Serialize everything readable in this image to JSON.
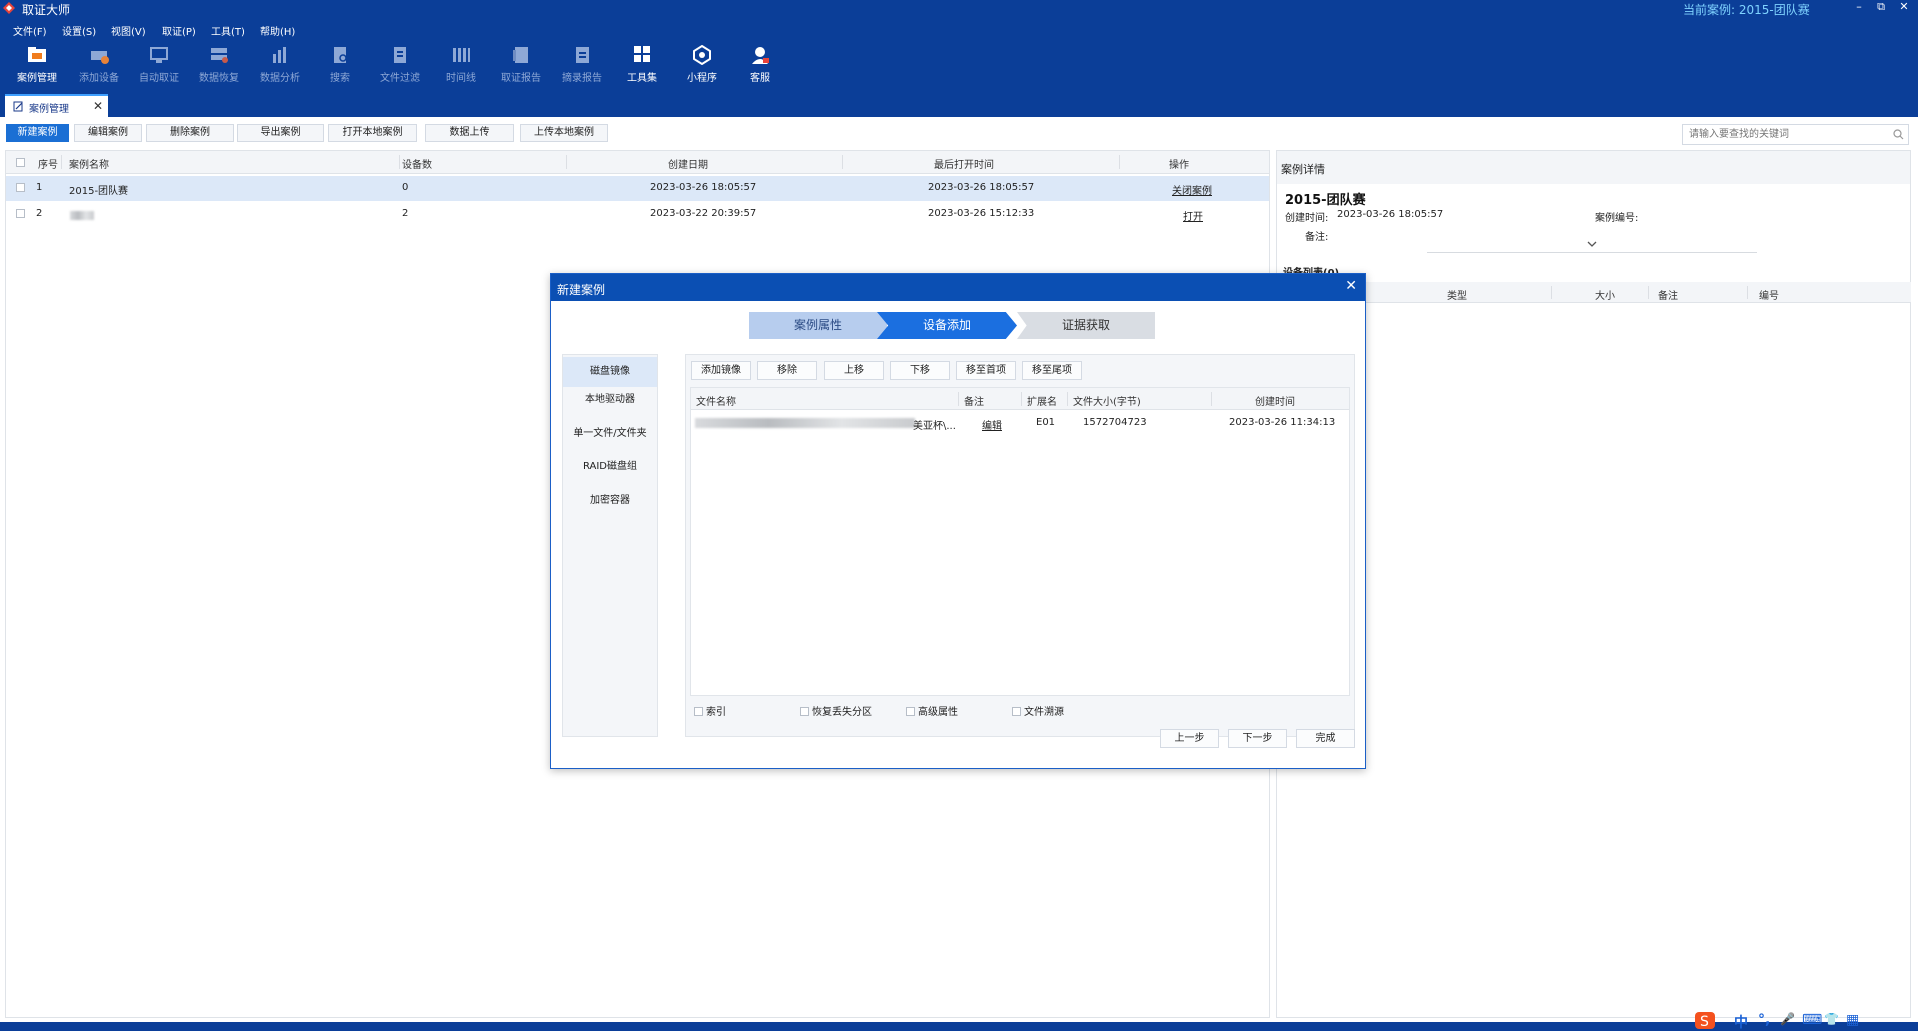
{
  "app": {
    "title": "取证大师",
    "current_case_label": "当前案例: 2015-团队赛",
    "window_buttons": [
      "–",
      "⧉",
      "✕"
    ]
  },
  "menu": [
    "文件(F)",
    "设置(S)",
    "视图(V)",
    "取证(P)",
    "工具(T)",
    "帮助(H)"
  ],
  "toolbar": [
    {
      "label": "案例管理",
      "icon": "case-manage-icon"
    },
    {
      "label": "添加设备",
      "icon": "add-device-icon"
    },
    {
      "label": "自动取证",
      "icon": "auto-forensic-icon"
    },
    {
      "label": "数据恢复",
      "icon": "data-recovery-icon"
    },
    {
      "label": "数据分析",
      "icon": "data-analysis-icon"
    },
    {
      "label": "搜索",
      "icon": "search-doc-icon"
    },
    {
      "label": "文件过滤",
      "icon": "file-filter-icon"
    },
    {
      "label": "时间线",
      "icon": "timeline-icon"
    },
    {
      "label": "取证报告",
      "icon": "report-icon"
    },
    {
      "label": "摘录报告",
      "icon": "excerpt-report-icon"
    },
    {
      "label": "工具集",
      "icon": "toolset-icon"
    },
    {
      "label": "小程序",
      "icon": "mini-program-icon"
    },
    {
      "label": "客服",
      "icon": "customer-service-icon"
    }
  ],
  "tab": {
    "label": "案例管理",
    "close": "✕"
  },
  "actions": [
    "新建案例",
    "编辑案例",
    "删除案例",
    "导出案例",
    "打开本地案例",
    "数据上传",
    "上传本地案例"
  ],
  "search": {
    "placeholder": "请输入要查找的关键词"
  },
  "case_table": {
    "headers": [
      "序号",
      "案例名称",
      "设备数",
      "创建日期",
      "最后打开时间",
      "操作"
    ],
    "rows": [
      {
        "index": "1",
        "name": "2015-团队赛",
        "devices": "0",
        "created": "2023-03-26 18:05:57",
        "last_opened": "2023-03-26 18:05:57",
        "action": "关闭案例"
      },
      {
        "index": "2",
        "name": "",
        "devices": "2",
        "created": "2023-03-22 20:39:57",
        "last_opened": "2023-03-26 15:12:33",
        "action": "打开"
      }
    ]
  },
  "detail": {
    "header": "案例详情",
    "title": "2015-团队赛",
    "created_label": "创建时间:",
    "created_value": "2023-03-26 18:05:57",
    "case_no_label": "案例编号:",
    "remark_label": "备注:",
    "device_list_label": "设备列表(0)",
    "device_headers": [
      "类型",
      "大小",
      "备注",
      "编号"
    ]
  },
  "dialog": {
    "title": "新建案例",
    "steps": [
      "案例属性",
      "设备添加",
      "证据获取"
    ],
    "side_items": [
      "磁盘镜像",
      "本地驱动器",
      "单一文件/文件夹",
      "RAID磁盘组",
      "加密容器"
    ],
    "buttons": [
      "添加镜像",
      "移除",
      "上移",
      "下移",
      "移至首项",
      "移至尾项"
    ],
    "file_headers": [
      "文件名称",
      "备注",
      "扩展名",
      "文件大小(字节)",
      "创建时间"
    ],
    "file_rows": [
      {
        "name_tail": "美亚杯\\...",
        "remark": "编辑",
        "ext": "E01",
        "size": "1572704723",
        "created": "2023-03-26 11:34:13"
      }
    ],
    "options": [
      "索引",
      "恢复丢失分区",
      "高级属性",
      "文件溯源"
    ],
    "footer": [
      "上一步",
      "下一步",
      "完成"
    ]
  },
  "tray": [
    "中",
    "°,",
    "🎤",
    "⌨",
    "👕",
    "▦"
  ]
}
